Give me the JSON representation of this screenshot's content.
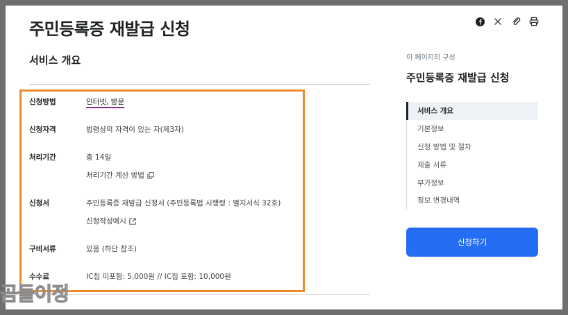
{
  "page": {
    "title": "주민등록증 재발급 신청",
    "share_icons": [
      "facebook-icon",
      "x-icon",
      "link-icon",
      "print-icon"
    ]
  },
  "overview": {
    "section_title": "서비스 개요",
    "rows": [
      {
        "label": "신청방법",
        "value": "인터넷, 방문"
      },
      {
        "label": "신청자격",
        "value": "법령상의 자격이 있는 자(제3자)"
      },
      {
        "label": "처리기간",
        "value": "총 14일",
        "sub_link": "처리기간 계산 방법"
      },
      {
        "label": "신청서",
        "value": "주민등록증 재발급 신청서 (주민등록법 시행령 : 별지서식 32호)",
        "sub_link": "신청작성예시"
      },
      {
        "label": "구비서류",
        "value": "있음 (하단 참조)"
      },
      {
        "label": "수수료",
        "value": "IC칩 미포함: 5,000원 // IC칩 포함: 10,000원"
      }
    ]
  },
  "toc": {
    "caption": "이 페이지의 구성",
    "title": "주민등록증 재발급 신청",
    "items": [
      "서비스 개요",
      "기본정보",
      "신청 방법 및 절차",
      "제출 서류",
      "부가정보",
      "정보 변경내역"
    ],
    "active_index": 0
  },
  "apply_button": "신청하기",
  "watermark": "곰돌이정",
  "colors": {
    "accent_button": "#256ef4",
    "highlight_border": "#ef8a2c",
    "link_underline": "#8a2c91"
  }
}
